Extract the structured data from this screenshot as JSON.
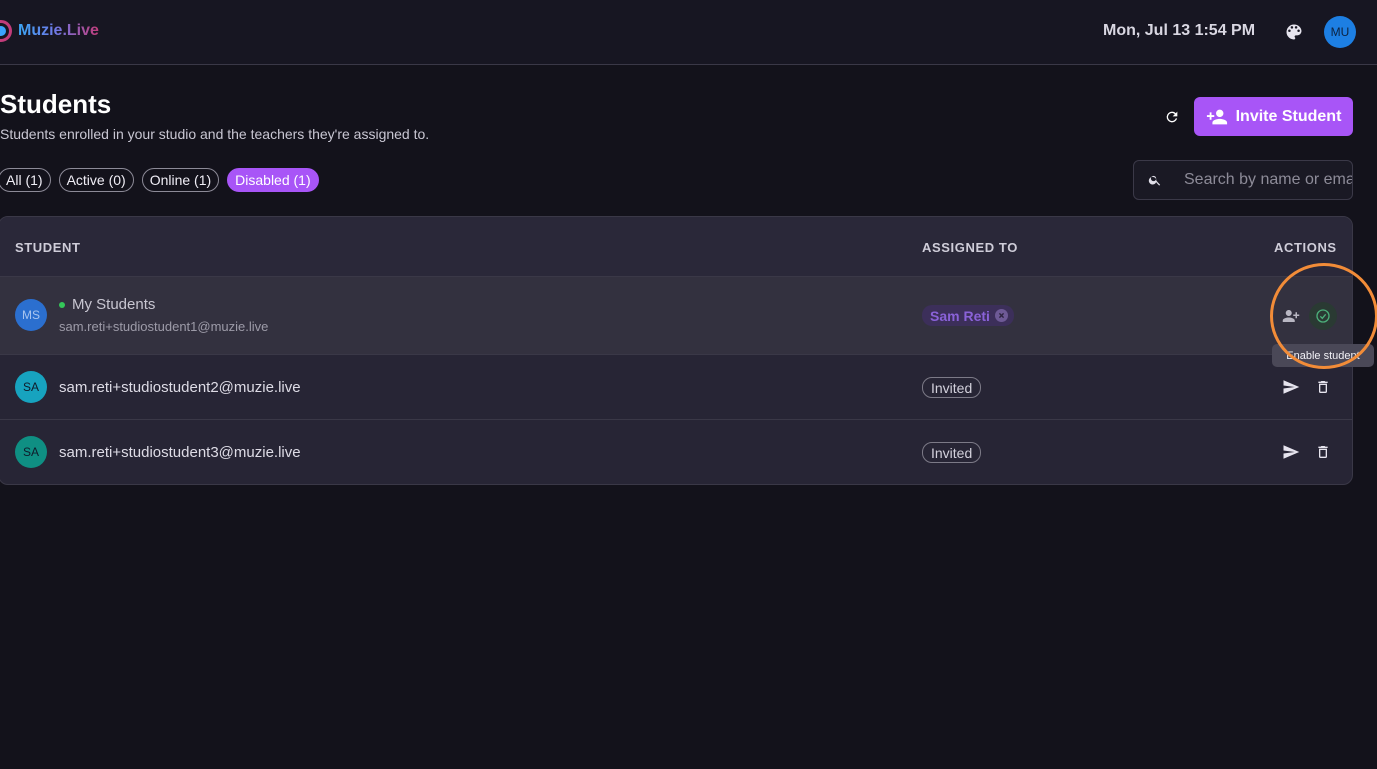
{
  "app": {
    "name": "Muzie.Live"
  },
  "header": {
    "datetime": "Mon, Jul 13 1:54 PM",
    "user_initials": "MU"
  },
  "page": {
    "title": "Students",
    "subtitle": "Students enrolled in your studio and the teachers they're assigned to.",
    "invite_label": "Invite Student"
  },
  "filters": [
    {
      "label": "All (1)"
    },
    {
      "label": "Active (0)"
    },
    {
      "label": "Online (1)"
    },
    {
      "label": "Disabled (1)",
      "active": true
    }
  ],
  "search": {
    "placeholder": "Search by name or email"
  },
  "table": {
    "columns": {
      "student": "STUDENT",
      "assigned": "ASSIGNED TO",
      "actions": "ACTIONS"
    },
    "rows": [
      {
        "initials": "MS",
        "name": "My Students",
        "email": "sam.reti+studiostudent1@muzie.live",
        "online": true,
        "assigned": "Sam Reti"
      },
      {
        "initials": "SA",
        "email": "sam.reti+studiostudent2@muzie.live",
        "assigned": "Invited"
      },
      {
        "initials": "SA",
        "email": "sam.reti+studiostudent3@muzie.live",
        "assigned": "Invited"
      }
    ]
  },
  "tooltip": {
    "text": "Enable student"
  },
  "colors": {
    "accent": "#a855f7",
    "background": "#13121b",
    "highlight": "#f28c38",
    "online": "#34c759"
  }
}
